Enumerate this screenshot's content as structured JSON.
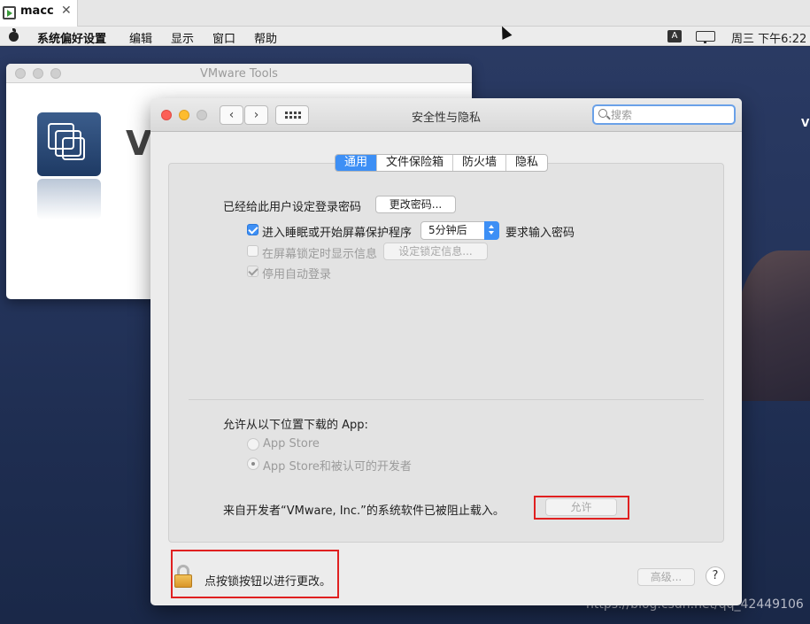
{
  "vm_tab": {
    "label": "macc",
    "close": "✕"
  },
  "menubar": {
    "app": "系统偏好设置",
    "items": [
      "编辑",
      "显示",
      "窗口",
      "帮助"
    ],
    "input_badge": "A",
    "clock": "周三 下午6:22"
  },
  "desktop": {
    "edge_text": "V",
    "watermark": "https://blog.csdn.net/qq_42449106"
  },
  "vmware_tools_window": {
    "title": "VMware Tools",
    "heading": "V"
  },
  "security_window": {
    "title": "安全性与隐私",
    "search_placeholder": "搜索",
    "back": "‹",
    "forward": "›",
    "tabs": [
      {
        "label": "通用",
        "active": true
      },
      {
        "label": "文件保险箱",
        "active": false
      },
      {
        "label": "防火墙",
        "active": false
      },
      {
        "label": "隐私",
        "active": false
      }
    ],
    "general": {
      "password_label": "已经给此用户设定登录密码",
      "change_password_button": "更改密码...",
      "require_password_label": "进入睡眠或开始屏幕保护程序",
      "require_password_delay": "5分钟后",
      "require_password_suffix": "要求输入密码",
      "show_message_label": "在屏幕锁定时显示信息",
      "set_lock_message_button": "设定锁定信息...",
      "disable_autologin_label": "停用自动登录",
      "allow_apps_label": "允许从以下位置下载的 App:",
      "radio_app_store": "App Store",
      "radio_app_store_dev": "App Store和被认可的开发者",
      "blocked_message": "来自开发者“VMware, Inc.”的系统软件已被阻止载入。",
      "allow_button": "允许"
    },
    "footer": {
      "lock_text": "点按锁按钮以进行更改。",
      "advanced_button": "高级...",
      "help_button": "?"
    }
  },
  "colors": {
    "accent": "#3d8ff5",
    "highlight_box": "#e02020"
  }
}
